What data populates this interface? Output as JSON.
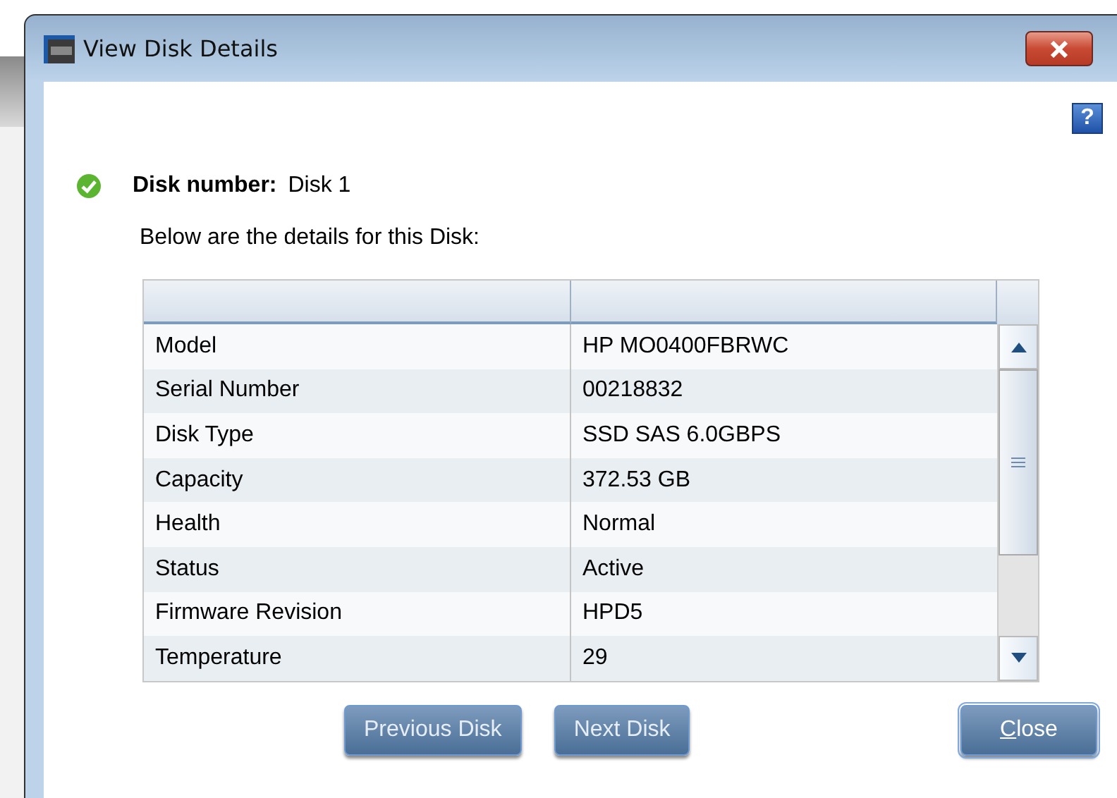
{
  "window": {
    "title": "View Disk Details"
  },
  "help": {
    "label": "?"
  },
  "disk": {
    "label": "Disk number:",
    "value": "Disk 1"
  },
  "intro": "Below are the details for this Disk:",
  "table": {
    "rows": [
      {
        "name": "Model",
        "value": "HP MO0400FBRWC"
      },
      {
        "name": "Serial Number",
        "value": "00218832"
      },
      {
        "name": "Disk Type",
        "value": "SSD SAS 6.0GBPS"
      },
      {
        "name": "Capacity",
        "value": "372.53 GB"
      },
      {
        "name": "Health",
        "value": "Normal"
      },
      {
        "name": "Status",
        "value": "Active"
      },
      {
        "name": "Firmware Revision",
        "value": "HPD5"
      },
      {
        "name": "Temperature",
        "value": "29"
      }
    ]
  },
  "buttons": [
    {
      "label": "Previous Disk",
      "kind": "nav"
    },
    {
      "label": "Next Disk",
      "kind": "nav"
    },
    {
      "label": "Close",
      "kind": "default"
    }
  ]
}
